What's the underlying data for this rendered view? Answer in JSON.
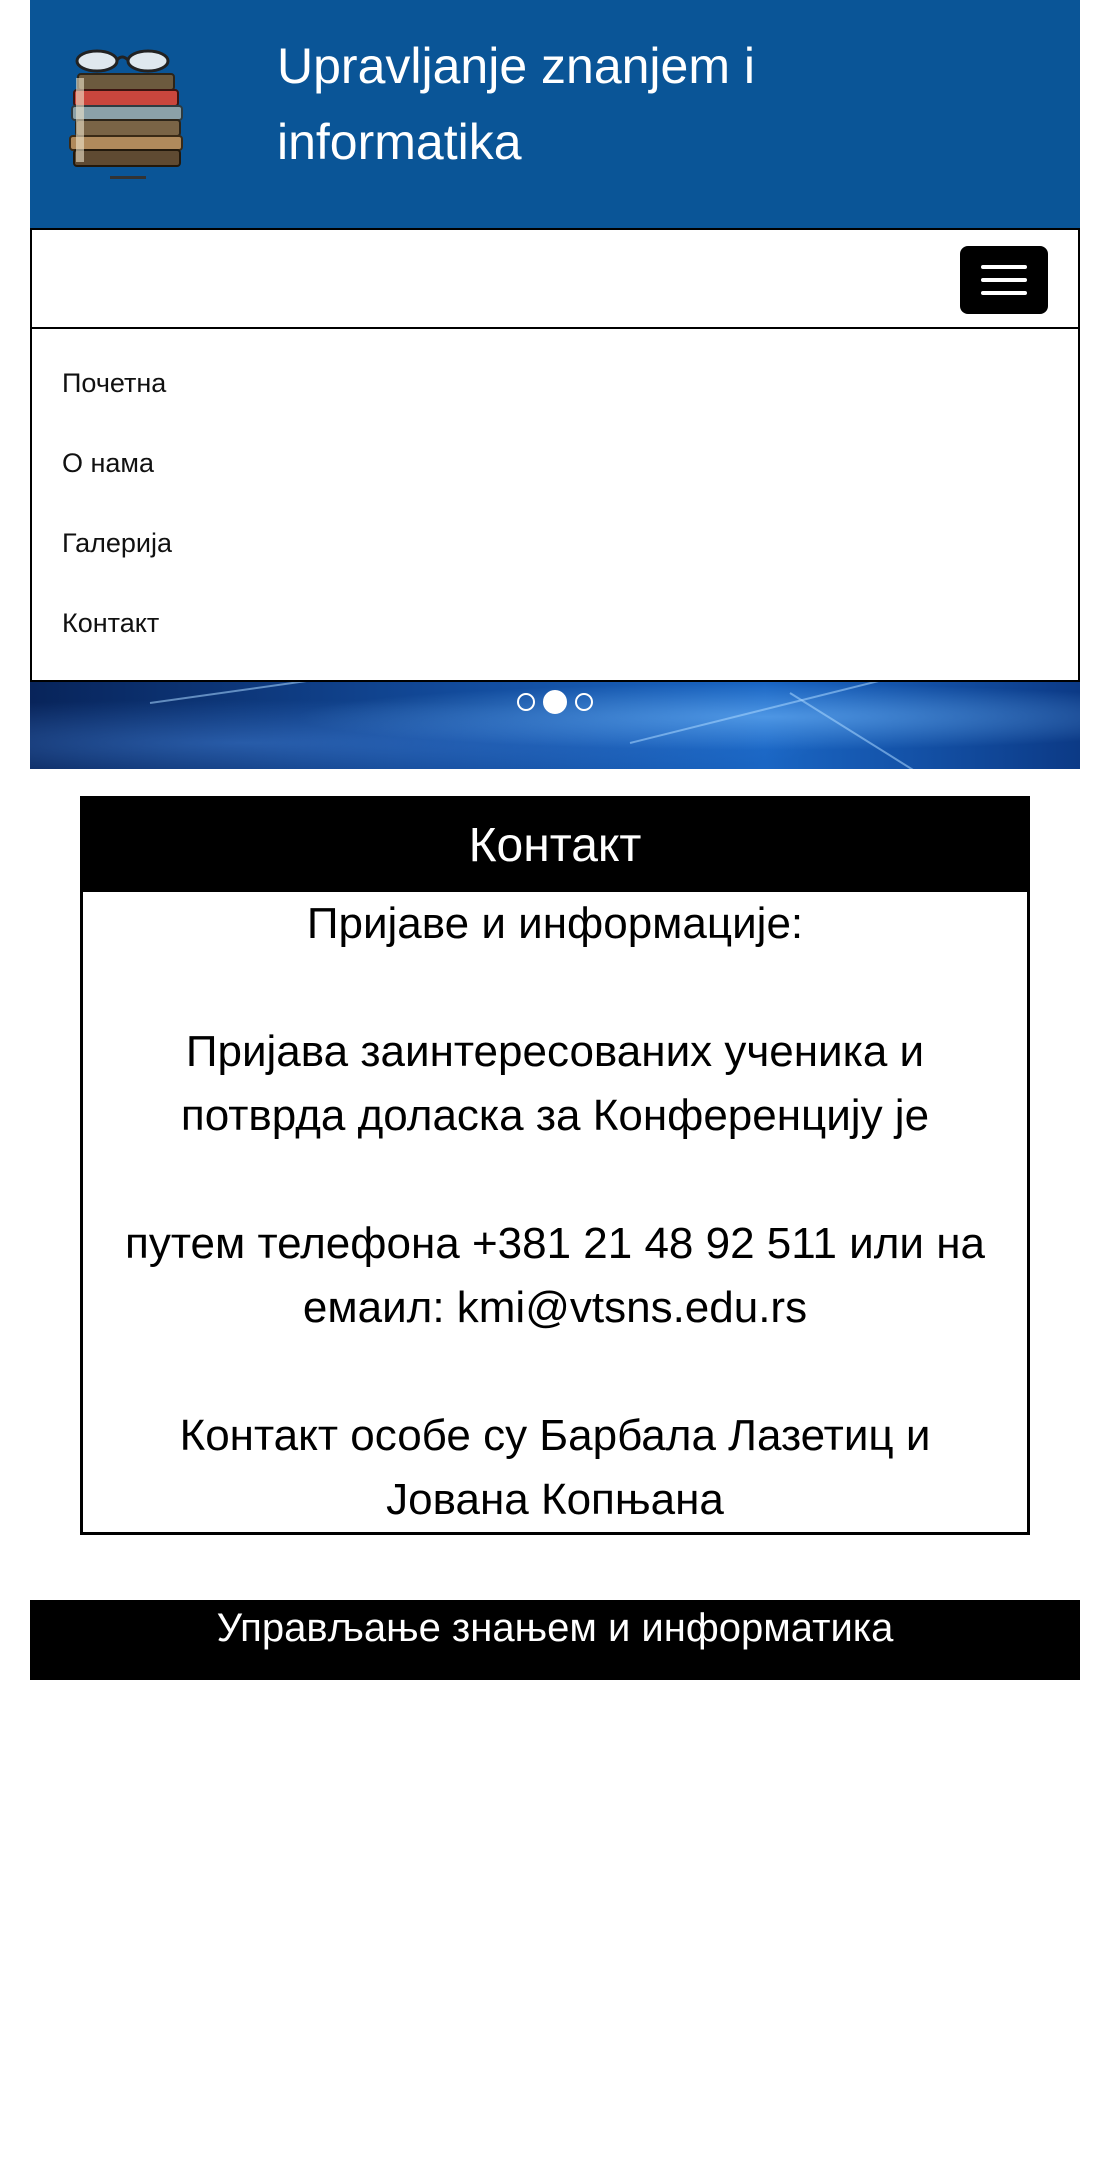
{
  "header": {
    "title": "Upravljanje znanjem i informatika",
    "logo_icon": "book-stack-glasses-icon"
  },
  "navbar": {
    "toggle_icon": "hamburger-menu-icon",
    "items": [
      {
        "label": "Почетна"
      },
      {
        "label": "О нама"
      },
      {
        "label": "Галерија"
      },
      {
        "label": "Контакт"
      }
    ]
  },
  "carousel": {
    "slide_count": 3,
    "active_index": 1
  },
  "contact": {
    "heading": "Контакт",
    "line1": "Пријаве и информације:",
    "line2": "Пријава заинтересованих ученика и потврда доласка за Конференцију је",
    "line3": "путем телефона +381 21 48 92 511 или на емаил: kmi@vtsns.edu.rs",
    "line4": "Контакт особе су Барбала Лазетиц и Јована Копњана"
  },
  "footer": {
    "text": "Управљање знањем и информатика"
  },
  "colors": {
    "header_bg": "#0a5597",
    "dark": "#000000",
    "text_light": "#ffffff"
  }
}
